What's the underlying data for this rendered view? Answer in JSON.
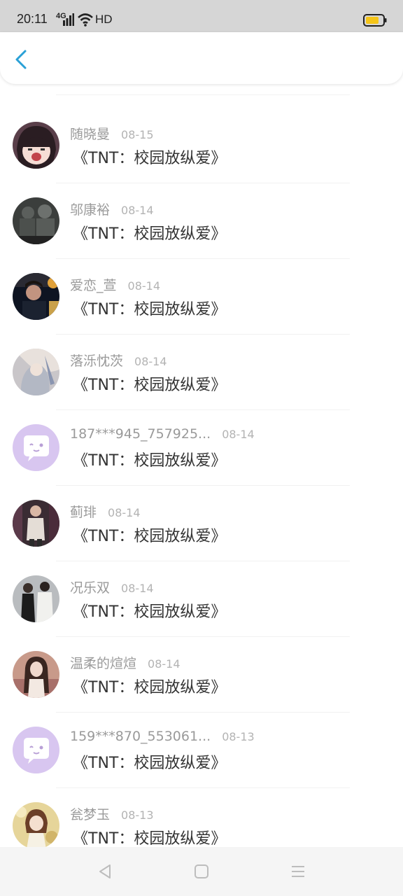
{
  "status_bar": {
    "time": "20:11",
    "network": "4G",
    "hd": "HD",
    "icons": [
      "signal-icon",
      "wifi-icon",
      "battery-icon"
    ],
    "battery_color": "#f5c518"
  },
  "header": {
    "back_icon": "chevron-left-icon",
    "accent_color": "#2aa0d6"
  },
  "items": [
    {
      "name": "随晓曼",
      "date": "08-15",
      "title": "《TNT：校园放纵爱》",
      "avatar": "anime-girl"
    },
    {
      "name": "邬康裕",
      "date": "08-14",
      "title": "《TNT：校园放纵爱》",
      "avatar": "soldiers-photo"
    },
    {
      "name": "爱恋_萱",
      "date": "08-14",
      "title": "《TNT：校园放纵爱》",
      "avatar": "boy-photo"
    },
    {
      "name": "落泺忱茨",
      "date": "08-14",
      "title": "《TNT：校园放纵爱》",
      "avatar": "painting-girl"
    },
    {
      "name": "187***945_757925...",
      "date": "08-14",
      "title": "《TNT：校园放纵爱》",
      "avatar": "default-chat"
    },
    {
      "name": "蓟琲",
      "date": "08-14",
      "title": "《TNT：校园放纵爱》",
      "avatar": "man-coat"
    },
    {
      "name": "况乐双",
      "date": "08-14",
      "title": "《TNT：校园放纵爱》",
      "avatar": "couple-photo"
    },
    {
      "name": "温柔的煊煊",
      "date": "08-14",
      "title": "《TNT：校园放纵爱》",
      "avatar": "girl-illustration"
    },
    {
      "name": "159***870_553061...",
      "date": "08-13",
      "title": "《TNT：校园放纵爱》",
      "avatar": "default-chat"
    },
    {
      "name": "瓮梦玉",
      "date": "08-13",
      "title": "《TNT：校园放纵爱》",
      "avatar": "girl-bokeh"
    }
  ],
  "nav": {
    "icons": [
      "back-triangle-icon",
      "home-square-icon",
      "menu-lines-icon"
    ]
  }
}
